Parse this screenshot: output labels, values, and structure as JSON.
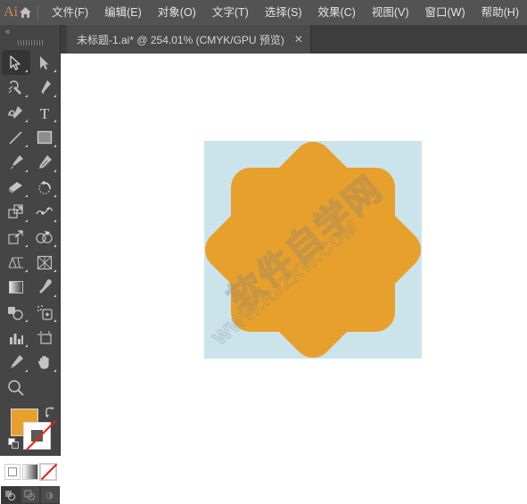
{
  "app": {
    "name": "Adobe Illustrator",
    "logo_text": "Ai",
    "home_icon": "home-icon"
  },
  "menubar": {
    "items": [
      {
        "label": "文件(F)",
        "name": "menu-file"
      },
      {
        "label": "编辑(E)",
        "name": "menu-edit"
      },
      {
        "label": "对象(O)",
        "name": "menu-object"
      },
      {
        "label": "文字(T)",
        "name": "menu-type"
      },
      {
        "label": "选择(S)",
        "name": "menu-select"
      },
      {
        "label": "效果(C)",
        "name": "menu-effect"
      },
      {
        "label": "视图(V)",
        "name": "menu-view"
      },
      {
        "label": "窗口(W)",
        "name": "menu-window"
      },
      {
        "label": "帮助(H)",
        "name": "menu-help"
      }
    ]
  },
  "tabbar": {
    "document_tab": {
      "title": "未标题-1.ai* @ 254.01% (CMYK/GPU 预览)",
      "filename": "未标题-1.ai",
      "modified": true,
      "zoom": "254.01%",
      "color_mode": "CMYK",
      "preview_mode": "GPU 预览",
      "close_label": "✕"
    }
  },
  "toolbar": {
    "collapse_label": "«",
    "tools": [
      {
        "name": "selection-tool",
        "label": "选择工具",
        "active": true,
        "has_flyout": true
      },
      {
        "name": "direct-selection-tool",
        "label": "直接选择工具",
        "active": false,
        "has_flyout": true
      },
      {
        "name": "magic-wand-tool",
        "label": "魔棒工具",
        "active": false,
        "has_flyout": true
      },
      {
        "name": "pen-tool",
        "label": "钢笔工具",
        "active": false,
        "has_flyout": true
      },
      {
        "name": "curvature-tool",
        "label": "曲率工具",
        "active": false,
        "has_flyout": true
      },
      {
        "name": "type-tool",
        "label": "文字工具",
        "active": false,
        "has_flyout": true
      },
      {
        "name": "line-segment-tool",
        "label": "直线段工具",
        "active": false,
        "has_flyout": true
      },
      {
        "name": "rectangle-tool",
        "label": "矩形工具",
        "active": false,
        "has_flyout": true
      },
      {
        "name": "paintbrush-tool",
        "label": "画笔工具",
        "active": false,
        "has_flyout": true
      },
      {
        "name": "shaper-tool",
        "label": "Shaper 工具",
        "active": false,
        "has_flyout": true
      },
      {
        "name": "eraser-tool",
        "label": "橡皮擦工具",
        "active": false,
        "has_flyout": true
      },
      {
        "name": "rotate-tool",
        "label": "旋转工具",
        "active": false,
        "has_flyout": true
      },
      {
        "name": "scale-tool",
        "label": "比例缩放工具",
        "active": false,
        "has_flyout": true
      },
      {
        "name": "width-tool",
        "label": "宽度工具",
        "active": false,
        "has_flyout": true
      },
      {
        "name": "free-transform-tool",
        "label": "自由变换工具",
        "active": false,
        "has_flyout": true
      },
      {
        "name": "shape-builder-tool",
        "label": "形状生成器工具",
        "active": false,
        "has_flyout": true
      },
      {
        "name": "perspective-grid-tool",
        "label": "透视网格工具",
        "active": false,
        "has_flyout": true
      },
      {
        "name": "mesh-tool",
        "label": "网格工具",
        "active": false,
        "has_flyout": true
      },
      {
        "name": "gradient-tool",
        "label": "渐变工具",
        "active": false,
        "has_flyout": false
      },
      {
        "name": "eyedropper-tool",
        "label": "吸管工具",
        "active": false,
        "has_flyout": true
      },
      {
        "name": "blend-tool",
        "label": "混合工具",
        "active": false,
        "has_flyout": true
      },
      {
        "name": "symbol-sprayer-tool",
        "label": "符号喷枪工具",
        "active": false,
        "has_flyout": true
      },
      {
        "name": "column-graph-tool",
        "label": "柱形图工具",
        "active": false,
        "has_flyout": true
      },
      {
        "name": "artboard-tool",
        "label": "画板工具",
        "active": false,
        "has_flyout": false
      },
      {
        "name": "slice-tool",
        "label": "切片工具",
        "active": false,
        "has_flyout": true
      },
      {
        "name": "hand-tool",
        "label": "抓手工具",
        "active": false,
        "has_flyout": true
      },
      {
        "name": "zoom-tool",
        "label": "缩放工具",
        "active": false,
        "has_flyout": false
      }
    ],
    "fill_color": "#E8A02C",
    "stroke_color": "none",
    "fill_label": "填色",
    "stroke_label": "描边",
    "swap_icon": "swap-fill-stroke-icon",
    "default_icon": "default-fill-stroke-icon",
    "paint_modes": [
      {
        "name": "color-mode-button",
        "label": "颜色",
        "selected": false
      },
      {
        "name": "gradient-mode-button",
        "label": "渐变",
        "selected": false
      },
      {
        "name": "none-mode-button",
        "label": "无",
        "selected": true
      }
    ],
    "draw_modes": [
      {
        "name": "draw-normal-button",
        "label": "正常绘图",
        "active": true
      },
      {
        "name": "draw-behind-button",
        "label": "背面绘图",
        "active": false
      },
      {
        "name": "draw-inside-button",
        "label": "内部绘图",
        "active": false
      }
    ]
  },
  "canvas": {
    "artboard_background": "#CBE4EC",
    "artwork": {
      "name": "rounded-octagram-star",
      "shape": "8-point rounded star",
      "fill": "#E8A02C",
      "points": 8
    },
    "watermark": {
      "text_cn": "软件自学网",
      "text_url": "WWW.RJZXW.COM"
    }
  }
}
